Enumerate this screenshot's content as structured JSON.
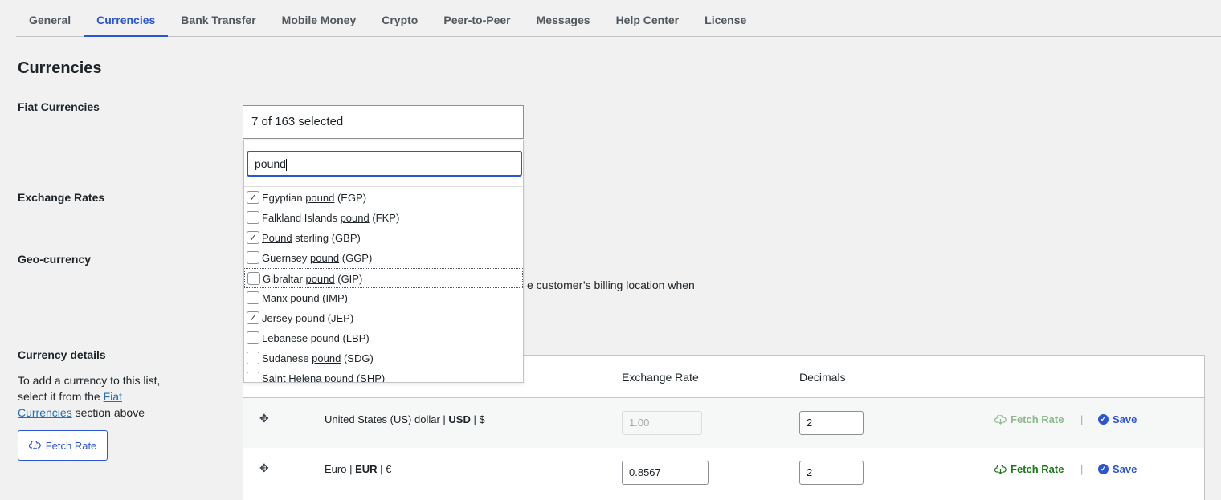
{
  "tabs": [
    "General",
    "Currencies",
    "Bank Transfer",
    "Mobile Money",
    "Crypto",
    "Peer-to-Peer",
    "Messages",
    "Help Center",
    "License"
  ],
  "active_tab": "Currencies",
  "heading": "Currencies",
  "labels": {
    "fiat": "Fiat Currencies",
    "exchange": "Exchange Rates",
    "geo": "Geo-currency",
    "details": "Currency details"
  },
  "fiat_select": {
    "value": "7 of 163 selected",
    "search": "pound",
    "options": [
      {
        "before": "Egyptian ",
        "match": "pound",
        "after": " (EGP)",
        "checked": true
      },
      {
        "before": "Falkland Islands ",
        "match": "pound",
        "after": " (FKP)",
        "checked": false
      },
      {
        "before": "",
        "match": "Pound",
        "after": " sterling (GBP)",
        "checked": true
      },
      {
        "before": "Guernsey ",
        "match": "pound",
        "after": " (GGP)",
        "checked": false
      },
      {
        "before": "Gibraltar ",
        "match": "pound",
        "after": " (GIP)",
        "checked": false
      },
      {
        "before": "Manx ",
        "match": "pound",
        "after": " (IMP)",
        "checked": false
      },
      {
        "before": "Jersey ",
        "match": "pound",
        "after": " (JEP)",
        "checked": true
      },
      {
        "before": "Lebanese ",
        "match": "pound",
        "after": " (LBP)",
        "checked": false
      },
      {
        "before": "Sudanese ",
        "match": "pound",
        "after": " (SDG)",
        "checked": false
      },
      {
        "before": "Saint Helena ",
        "match": "pound",
        "after": " (SHP)",
        "checked": false
      }
    ]
  },
  "geo_text": "e customer’s billing location when",
  "details": {
    "desc_pre": "To add a currency to this list, select it from the ",
    "desc_link": "Fiat Currencies",
    "desc_post": " section above",
    "fetch_button": "Fetch Rate"
  },
  "table": {
    "col_rate": "Exchange Rate",
    "col_decimals": "Decimals",
    "rows": [
      {
        "name": "United States (US) dollar",
        "code": "USD",
        "symbol": "$",
        "rate": "1.00",
        "decimals": "2",
        "fetch": "Fetch Rate",
        "save": "Save"
      },
      {
        "name": "Euro",
        "code": "EUR",
        "symbol": "€",
        "rate": "0.8567",
        "decimals": "2",
        "fetch": "Fetch Rate",
        "save": "Save"
      }
    ]
  },
  "colors": {
    "accent": "#2c55d3",
    "fetch_green": "#1a7a1a"
  }
}
